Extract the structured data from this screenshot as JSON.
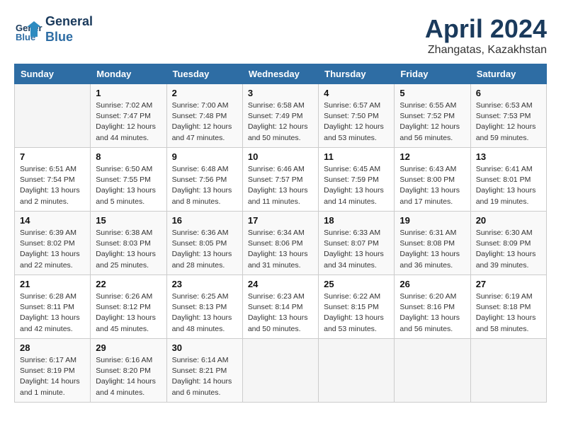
{
  "header": {
    "logo_line1": "General",
    "logo_line2": "Blue",
    "month": "April 2024",
    "location": "Zhangatas, Kazakhstan"
  },
  "weekdays": [
    "Sunday",
    "Monday",
    "Tuesday",
    "Wednesday",
    "Thursday",
    "Friday",
    "Saturday"
  ],
  "weeks": [
    [
      {
        "day": "",
        "info": ""
      },
      {
        "day": "1",
        "info": "Sunrise: 7:02 AM\nSunset: 7:47 PM\nDaylight: 12 hours\nand 44 minutes."
      },
      {
        "day": "2",
        "info": "Sunrise: 7:00 AM\nSunset: 7:48 PM\nDaylight: 12 hours\nand 47 minutes."
      },
      {
        "day": "3",
        "info": "Sunrise: 6:58 AM\nSunset: 7:49 PM\nDaylight: 12 hours\nand 50 minutes."
      },
      {
        "day": "4",
        "info": "Sunrise: 6:57 AM\nSunset: 7:50 PM\nDaylight: 12 hours\nand 53 minutes."
      },
      {
        "day": "5",
        "info": "Sunrise: 6:55 AM\nSunset: 7:52 PM\nDaylight: 12 hours\nand 56 minutes."
      },
      {
        "day": "6",
        "info": "Sunrise: 6:53 AM\nSunset: 7:53 PM\nDaylight: 12 hours\nand 59 minutes."
      }
    ],
    [
      {
        "day": "7",
        "info": "Sunrise: 6:51 AM\nSunset: 7:54 PM\nDaylight: 13 hours\nand 2 minutes."
      },
      {
        "day": "8",
        "info": "Sunrise: 6:50 AM\nSunset: 7:55 PM\nDaylight: 13 hours\nand 5 minutes."
      },
      {
        "day": "9",
        "info": "Sunrise: 6:48 AM\nSunset: 7:56 PM\nDaylight: 13 hours\nand 8 minutes."
      },
      {
        "day": "10",
        "info": "Sunrise: 6:46 AM\nSunset: 7:57 PM\nDaylight: 13 hours\nand 11 minutes."
      },
      {
        "day": "11",
        "info": "Sunrise: 6:45 AM\nSunset: 7:59 PM\nDaylight: 13 hours\nand 14 minutes."
      },
      {
        "day": "12",
        "info": "Sunrise: 6:43 AM\nSunset: 8:00 PM\nDaylight: 13 hours\nand 17 minutes."
      },
      {
        "day": "13",
        "info": "Sunrise: 6:41 AM\nSunset: 8:01 PM\nDaylight: 13 hours\nand 19 minutes."
      }
    ],
    [
      {
        "day": "14",
        "info": "Sunrise: 6:39 AM\nSunset: 8:02 PM\nDaylight: 13 hours\nand 22 minutes."
      },
      {
        "day": "15",
        "info": "Sunrise: 6:38 AM\nSunset: 8:03 PM\nDaylight: 13 hours\nand 25 minutes."
      },
      {
        "day": "16",
        "info": "Sunrise: 6:36 AM\nSunset: 8:05 PM\nDaylight: 13 hours\nand 28 minutes."
      },
      {
        "day": "17",
        "info": "Sunrise: 6:34 AM\nSunset: 8:06 PM\nDaylight: 13 hours\nand 31 minutes."
      },
      {
        "day": "18",
        "info": "Sunrise: 6:33 AM\nSunset: 8:07 PM\nDaylight: 13 hours\nand 34 minutes."
      },
      {
        "day": "19",
        "info": "Sunrise: 6:31 AM\nSunset: 8:08 PM\nDaylight: 13 hours\nand 36 minutes."
      },
      {
        "day": "20",
        "info": "Sunrise: 6:30 AM\nSunset: 8:09 PM\nDaylight: 13 hours\nand 39 minutes."
      }
    ],
    [
      {
        "day": "21",
        "info": "Sunrise: 6:28 AM\nSunset: 8:11 PM\nDaylight: 13 hours\nand 42 minutes."
      },
      {
        "day": "22",
        "info": "Sunrise: 6:26 AM\nSunset: 8:12 PM\nDaylight: 13 hours\nand 45 minutes."
      },
      {
        "day": "23",
        "info": "Sunrise: 6:25 AM\nSunset: 8:13 PM\nDaylight: 13 hours\nand 48 minutes."
      },
      {
        "day": "24",
        "info": "Sunrise: 6:23 AM\nSunset: 8:14 PM\nDaylight: 13 hours\nand 50 minutes."
      },
      {
        "day": "25",
        "info": "Sunrise: 6:22 AM\nSunset: 8:15 PM\nDaylight: 13 hours\nand 53 minutes."
      },
      {
        "day": "26",
        "info": "Sunrise: 6:20 AM\nSunset: 8:16 PM\nDaylight: 13 hours\nand 56 minutes."
      },
      {
        "day": "27",
        "info": "Sunrise: 6:19 AM\nSunset: 8:18 PM\nDaylight: 13 hours\nand 58 minutes."
      }
    ],
    [
      {
        "day": "28",
        "info": "Sunrise: 6:17 AM\nSunset: 8:19 PM\nDaylight: 14 hours\nand 1 minute."
      },
      {
        "day": "29",
        "info": "Sunrise: 6:16 AM\nSunset: 8:20 PM\nDaylight: 14 hours\nand 4 minutes."
      },
      {
        "day": "30",
        "info": "Sunrise: 6:14 AM\nSunset: 8:21 PM\nDaylight: 14 hours\nand 6 minutes."
      },
      {
        "day": "",
        "info": ""
      },
      {
        "day": "",
        "info": ""
      },
      {
        "day": "",
        "info": ""
      },
      {
        "day": "",
        "info": ""
      }
    ]
  ]
}
